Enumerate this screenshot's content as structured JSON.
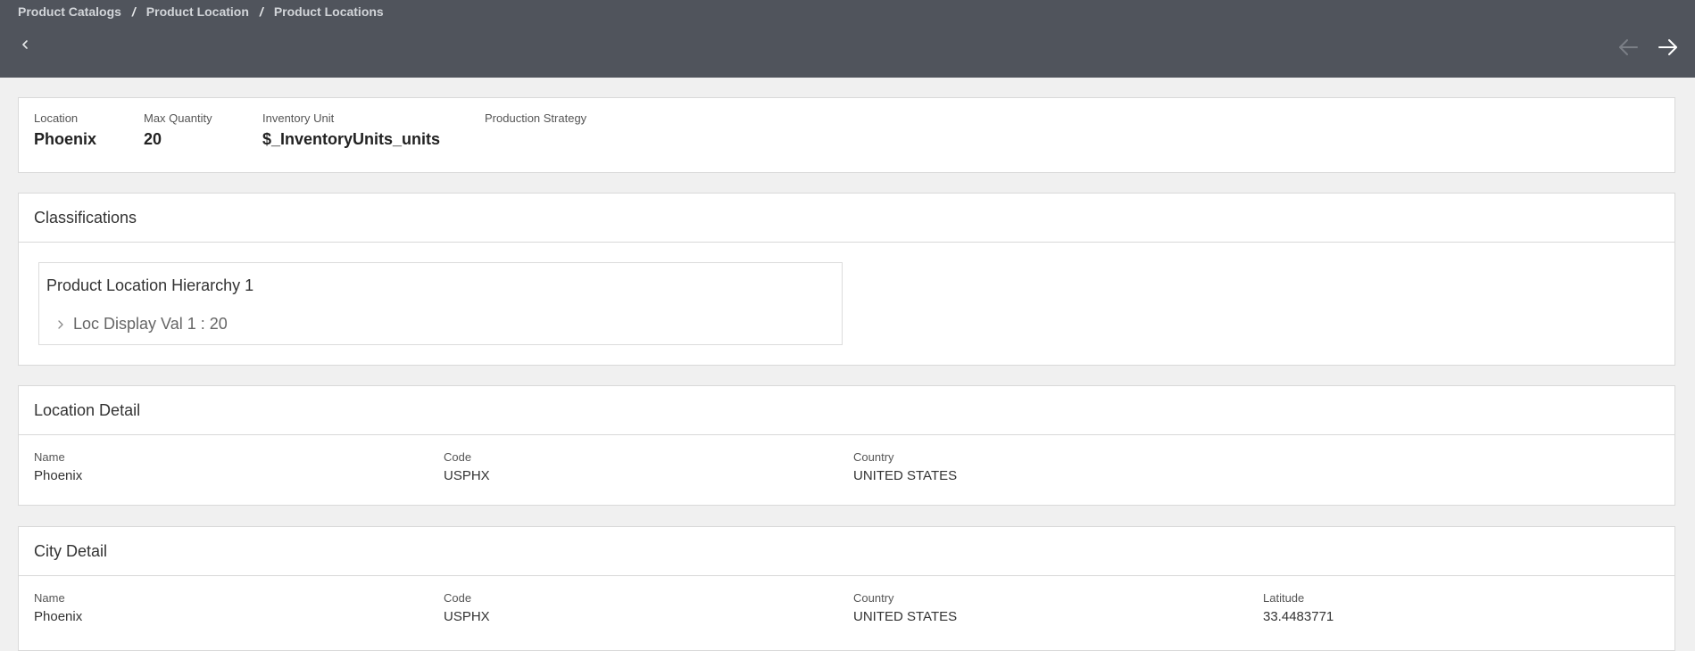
{
  "breadcrumb": {
    "items": [
      "Product Catalogs",
      "Product Location",
      "Product Locations"
    ],
    "separator": "/"
  },
  "header": {
    "back_icon": "chevron-left-icon",
    "prev_icon": "arrow-left-icon",
    "next_icon": "arrow-right-icon",
    "prev_enabled": false,
    "next_enabled": true
  },
  "summary": {
    "location_label": "Location",
    "location_value": "Phoenix",
    "max_quantity_label": "Max Quantity",
    "max_quantity_value": "20",
    "inventory_unit_label": "Inventory Unit",
    "inventory_unit_value": "$_InventoryUnits_units",
    "production_strategy_label": "Production Strategy",
    "production_strategy_value": ""
  },
  "classifications": {
    "title": "Classifications",
    "hierarchy_title": "Product Location Hierarchy 1",
    "item_label": "Loc Display Val 1 : 20"
  },
  "location_detail": {
    "title": "Location Detail",
    "name_label": "Name",
    "name_value": "Phoenix",
    "code_label": "Code",
    "code_value": "USPHX",
    "country_label": "Country",
    "country_value": "UNITED STATES"
  },
  "city_detail": {
    "title": "City Detail",
    "name_label": "Name",
    "name_value": "Phoenix",
    "code_label": "Code",
    "code_value": "USPHX",
    "country_label": "Country",
    "country_value": "UNITED STATES",
    "latitude_label": "Latitude",
    "latitude_value": "33.4483771"
  },
  "colors": {
    "header_bg": "#50545c",
    "page_bg": "#f0f0f0",
    "card_bg": "#ffffff",
    "border": "#d9d9d9"
  }
}
